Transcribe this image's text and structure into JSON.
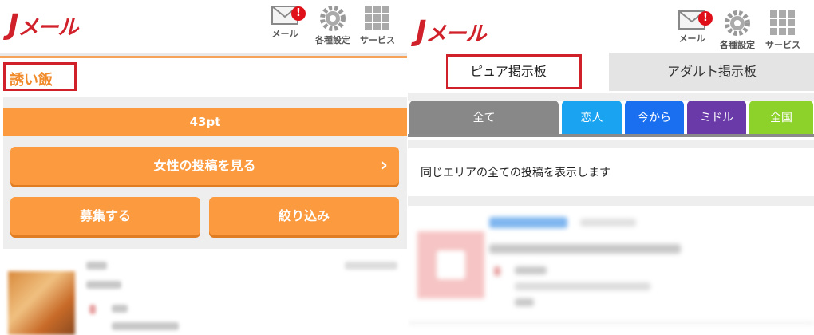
{
  "left": {
    "header": {
      "logo_j": "J",
      "logo_rest": "メール",
      "mail_label": "メール",
      "mail_badge": "!",
      "settings_label": "各種設定",
      "services_label": "サービス"
    },
    "page_title": "誘い飯",
    "points": "43pt",
    "view_button": "女性の投稿を見る",
    "view_chevron": "›",
    "recruit_button": "募集する",
    "filter_button": "絞り込み"
  },
  "right": {
    "header": {
      "logo_j": "J",
      "logo_rest": "メール",
      "mail_label": "メール",
      "mail_badge": "!",
      "settings_label": "各種設定",
      "services_label": "サービス"
    },
    "tabs": [
      "ピュア掲示板",
      "アダルト掲示板"
    ],
    "categories": [
      {
        "label": "全て",
        "color": "#888888"
      },
      {
        "label": "恋人",
        "color": "#1aa3f0"
      },
      {
        "label": "今から",
        "color": "#1a6ff0"
      },
      {
        "label": "ミドル",
        "color": "#6a3aa8"
      },
      {
        "label": "全国",
        "color": "#8cd22a"
      }
    ],
    "info_text": "同じエリアの全ての投稿を表示します"
  },
  "colors": {
    "brand_red": "#d0202a",
    "orange": "#fb9a3e",
    "highlight_box": "#d0202a"
  }
}
